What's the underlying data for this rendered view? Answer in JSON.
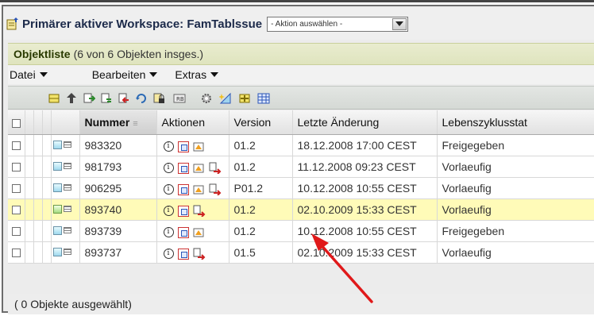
{
  "workspace": {
    "title": "Primärer aktiver Workspace: FamTablssue",
    "action_select": "- Aktion auswählen -"
  },
  "objectlist": {
    "title": "Objektliste",
    "count": "(6 von 6 Objekten insges.)"
  },
  "menu": {
    "file": "Datei",
    "edit": "Bearbeiten",
    "extras": "Extras"
  },
  "toolbar": {
    "icons": [
      "collapse-icon",
      "up-arrow-icon",
      "checkout-icon",
      "checkin-icon",
      "undo-checkout-icon",
      "refresh-icon",
      "lock-icon",
      "rename-icon",
      "gear-icon",
      "new-icon",
      "plus-icon",
      "table-icon"
    ]
  },
  "table": {
    "columns": [
      "Nummer",
      "Aktionen",
      "Version",
      "Letzte Änderung",
      "Lebenszyklusstat"
    ],
    "rows": [
      {
        "number": "983320",
        "version": "01.2",
        "modified": "18.12.2008 17:00 CEST",
        "state": "Freigegeben",
        "highlight": false
      },
      {
        "number": "981793",
        "version": "01.2",
        "modified": "11.12.2008 09:23 CEST",
        "state": "Vorlaeufig",
        "highlight": false
      },
      {
        "number": "906295",
        "version": "P01.2",
        "modified": "10.12.2008 10:55 CEST",
        "state": "Vorlaeufig",
        "highlight": false
      },
      {
        "number": "893740",
        "version": "01.2",
        "modified": "02.10.2009 15:33 CEST",
        "state": "Vorlaeufig",
        "highlight": true
      },
      {
        "number": "893739",
        "version": "01.2",
        "modified": "10.12.2008 10:55 CEST",
        "state": "Freigegeben",
        "highlight": false
      },
      {
        "number": "893737",
        "version": "01.5",
        "modified": "02.10.2009 15:33 CEST",
        "state": "Vorlaeufig",
        "highlight": false
      }
    ]
  },
  "status": {
    "selected": "( 0 Objekte ausgewählt)"
  },
  "colors": {
    "highlight": "#fffbb8",
    "arrow": "#e0191a",
    "listhead": "#e2e6c4"
  }
}
